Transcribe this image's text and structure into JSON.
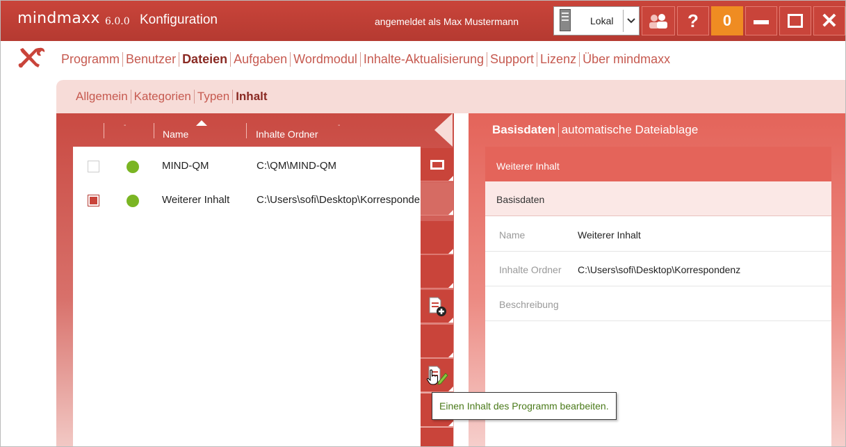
{
  "titlebar": {
    "app_name": "mindmaxx",
    "version": "6.0.0",
    "module": "Konfiguration",
    "login_text": "angemeldet als Max Mustermann",
    "server_label": "Lokal",
    "notification_count": "0",
    "help_label": "?",
    "close_label": "✕"
  },
  "main_menu": {
    "items": [
      "Programm",
      "Benutzer",
      "Dateien",
      "Aufgaben",
      "Wordmodul",
      "Inhalte-Aktualisierung",
      "Support",
      "Lizenz",
      "Über mindmaxx"
    ],
    "active": "Dateien"
  },
  "sub_menu": {
    "items": [
      "Allgemein",
      "Kategorien",
      "Typen",
      "Inhalt"
    ],
    "active": "Inhalt"
  },
  "grid": {
    "columns": [
      "Name",
      "Inhalte Ordner"
    ],
    "rows": [
      {
        "name": "MIND-QM",
        "path": "C:\\QM\\MIND-QM",
        "checked": false,
        "status": "green"
      },
      {
        "name": "Weiterer Inhalt",
        "path": "C:\\Users\\sofi\\Desktop\\Korrespondenz",
        "checked": true,
        "status": "green"
      }
    ]
  },
  "detail": {
    "tabs": [
      "Basisdaten",
      "automatische Dateiablage"
    ],
    "active_tab": "Basisdaten",
    "header": "Weiterer Inhalt",
    "section": "Basisdaten",
    "fields": [
      {
        "label": "Name",
        "value": "Weiterer Inhalt"
      },
      {
        "label": "Inhalte Ordner",
        "value": "C:\\Users\\sofi\\Desktop\\Korrespondenz"
      },
      {
        "label": "Beschreibung",
        "value": ""
      }
    ]
  },
  "tooltip": {
    "text": "Einen Inhalt des Programm bearbeiten."
  },
  "colors": {
    "brand_red": "#c9443a",
    "active_text": "#8a2a23",
    "menu_text": "#c65a50",
    "status_green": "#7ab523",
    "notification_orange": "#ef8c22"
  },
  "icons": {
    "tools": "tools-icon",
    "server": "server-icon",
    "users": "users-icon",
    "add_document": "add-document-icon",
    "edit_document": "edit-document-icon",
    "view_rect": "rectangle-icon"
  }
}
